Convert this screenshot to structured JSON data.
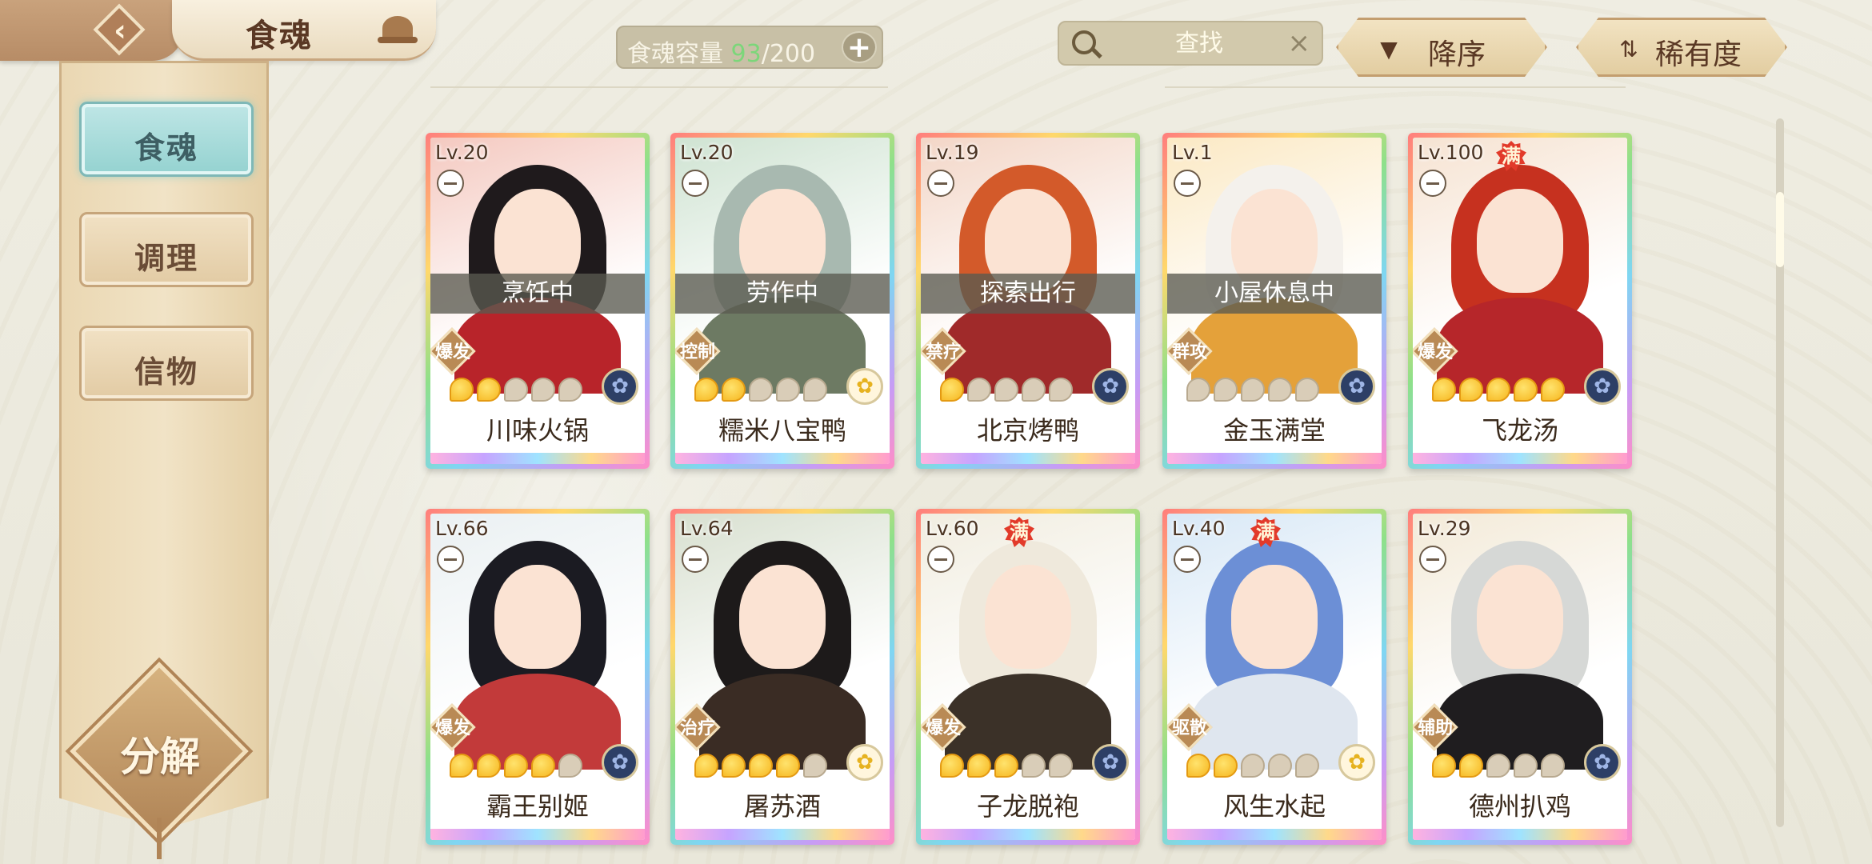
{
  "header": {
    "title": "食魂",
    "capacity_label": "食魂容量",
    "capacity_current": "93",
    "capacity_total": "/200",
    "search_placeholder": "查找",
    "sort_order_label": "降序",
    "sort_field_label": "稀有度"
  },
  "sidebar": {
    "items": [
      {
        "label": "食魂",
        "active": true
      },
      {
        "label": "调理",
        "active": false
      },
      {
        "label": "信物",
        "active": false
      }
    ],
    "decompose_label": "分解"
  },
  "cards": [
    {
      "level": "Lv.20",
      "status": "烹饪中",
      "role": "爆发",
      "stars": 2,
      "name": "川味火锅",
      "full": "",
      "element": "blue"
    },
    {
      "level": "Lv.20",
      "status": "劳作中",
      "role": "控制",
      "stars": 2,
      "name": "糯米八宝鸭",
      "full": "",
      "element": "gold"
    },
    {
      "level": "Lv.19",
      "status": "探索出行",
      "role": "禁疗",
      "stars": 1,
      "name": "北京烤鸭",
      "full": "",
      "element": "blue"
    },
    {
      "level": "Lv.1",
      "status": "小屋休息中",
      "role": "群攻",
      "stars": 0,
      "name": "金玉满堂",
      "full": "",
      "element": "blue"
    },
    {
      "level": "Lv.100",
      "status": "",
      "role": "爆发",
      "stars": 5,
      "name": "飞龙汤",
      "full": "满",
      "element": "blue"
    },
    {
      "level": "Lv.66",
      "status": "",
      "role": "爆发",
      "stars": 4,
      "name": "霸王别姬",
      "full": "",
      "element": "blue"
    },
    {
      "level": "Lv.64",
      "status": "",
      "role": "治疗",
      "stars": 4,
      "name": "屠苏酒",
      "full": "",
      "element": "gold"
    },
    {
      "level": "Lv.60",
      "status": "",
      "role": "爆发",
      "stars": 3,
      "name": "子龙脱袍",
      "full": "满",
      "element": "blue"
    },
    {
      "level": "Lv.40",
      "status": "",
      "role": "驱散",
      "stars": 2,
      "name": "风生水起",
      "full": "满",
      "element": "gold"
    },
    {
      "level": "Lv.29",
      "status": "",
      "role": "辅助",
      "stars": 2,
      "name": "德州扒鸡",
      "full": "",
      "element": "blue"
    }
  ],
  "colors": {
    "accent_active": "#94d2d0",
    "panel": "#ead7b2",
    "capacity_current": "#7cd67a",
    "full_badge": "#e23a2a"
  }
}
